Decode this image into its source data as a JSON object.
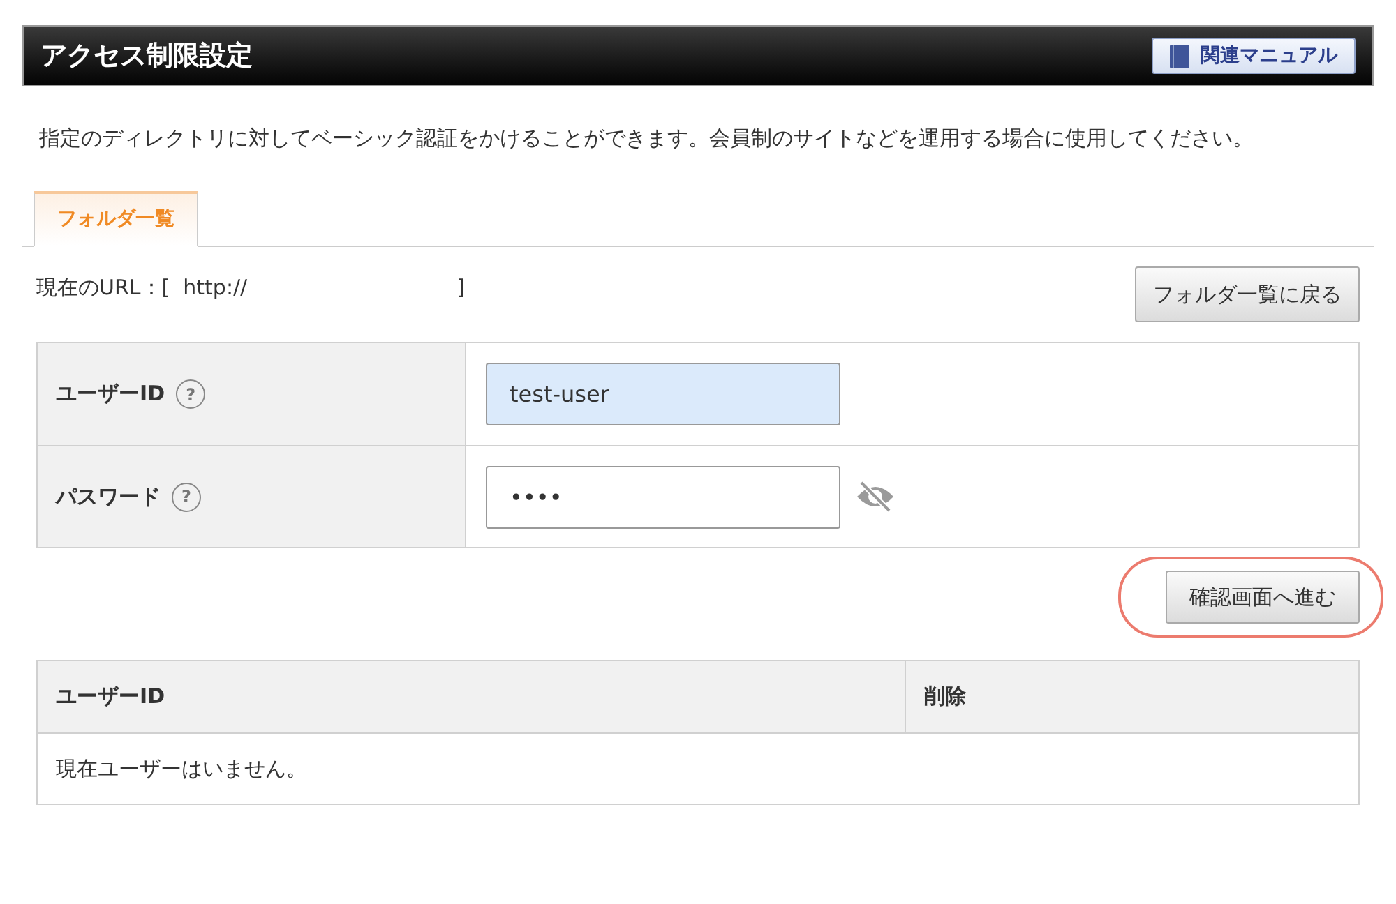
{
  "header": {
    "title": "アクセス制限設定",
    "manual_button": "関連マニュアル"
  },
  "description": "指定のディレクトリに対してベーシック認証をかけることができます。会員制のサイトなどを運用する場合に使用してください。",
  "tabs": [
    {
      "label": "フォルダ一覧",
      "selected": true
    }
  ],
  "url": {
    "label": "現在のURL：[  http://",
    "end": "]"
  },
  "back_button": "フォルダ一覧に戻る",
  "form": [
    {
      "label": "ユーザーID",
      "help": "?",
      "value": "test-user",
      "focused": true,
      "kind": "text"
    },
    {
      "label": "パスワード",
      "help": "?",
      "value": "••••",
      "focused": false,
      "kind": "password"
    }
  ],
  "confirm_button": {
    "label": "確認画面へ進む",
    "highlighted": true
  },
  "users_table": {
    "columns": [
      "ユーザーID",
      "削除"
    ],
    "empty_message": "現在ユーザーはいません。"
  }
}
